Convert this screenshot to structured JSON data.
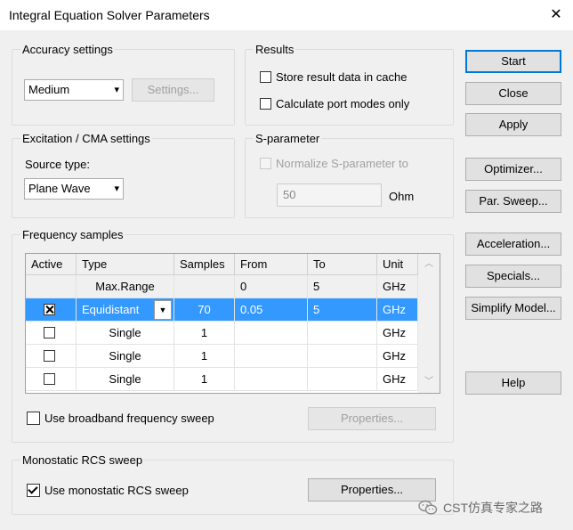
{
  "window": {
    "title": "Integral Equation Solver Parameters",
    "close_glyph": "✕"
  },
  "accuracy": {
    "group_label": "Accuracy settings",
    "value": "Medium",
    "settings_button": "Settings..."
  },
  "results": {
    "group_label": "Results",
    "store_cache": "Store result data in cache",
    "port_modes": "Calculate port modes only"
  },
  "excitation": {
    "group_label": "Excitation / CMA settings",
    "source_label": "Source type:",
    "source_value": "Plane Wave"
  },
  "sparam": {
    "group_label": "S-parameter",
    "normalize_label": "Normalize S-parameter to",
    "value": "50",
    "unit": "Ohm"
  },
  "freq": {
    "group_label": "Frequency samples",
    "columns": [
      "Active",
      "Type",
      "Samples",
      "From",
      "To",
      "Unit"
    ],
    "rows": [
      {
        "active": "",
        "type": "Max.Range",
        "samples": "",
        "from": "0",
        "to": "5",
        "unit": "GHz"
      },
      {
        "active": "x",
        "type": "Equidistant",
        "samples": "70",
        "from": "0.05",
        "to": "5",
        "unit": "GHz"
      },
      {
        "active": "",
        "type": "Single",
        "samples": "1",
        "from": "",
        "to": "",
        "unit": "GHz"
      },
      {
        "active": "",
        "type": "Single",
        "samples": "1",
        "from": "",
        "to": "",
        "unit": "GHz"
      },
      {
        "active": "",
        "type": "Single",
        "samples": "1",
        "from": "",
        "to": "",
        "unit": "GHz"
      }
    ],
    "broadband_label": "Use broadband frequency sweep",
    "properties_button": "Properties..."
  },
  "rcs": {
    "group_label": "Monostatic RCS sweep",
    "use_label": "Use monostatic RCS sweep",
    "properties_button": "Properties..."
  },
  "buttons": {
    "start": "Start",
    "close": "Close",
    "apply": "Apply",
    "optimizer": "Optimizer...",
    "par_sweep": "Par. Sweep...",
    "acceleration": "Acceleration...",
    "specials": "Specials...",
    "simplify": "Simplify Model...",
    "help": "Help"
  },
  "watermark": {
    "text": "CST仿真专家之路",
    "icon": "wechat-icon"
  },
  "colors": {
    "accent": "#0078d7",
    "selection": "#3399ff"
  }
}
